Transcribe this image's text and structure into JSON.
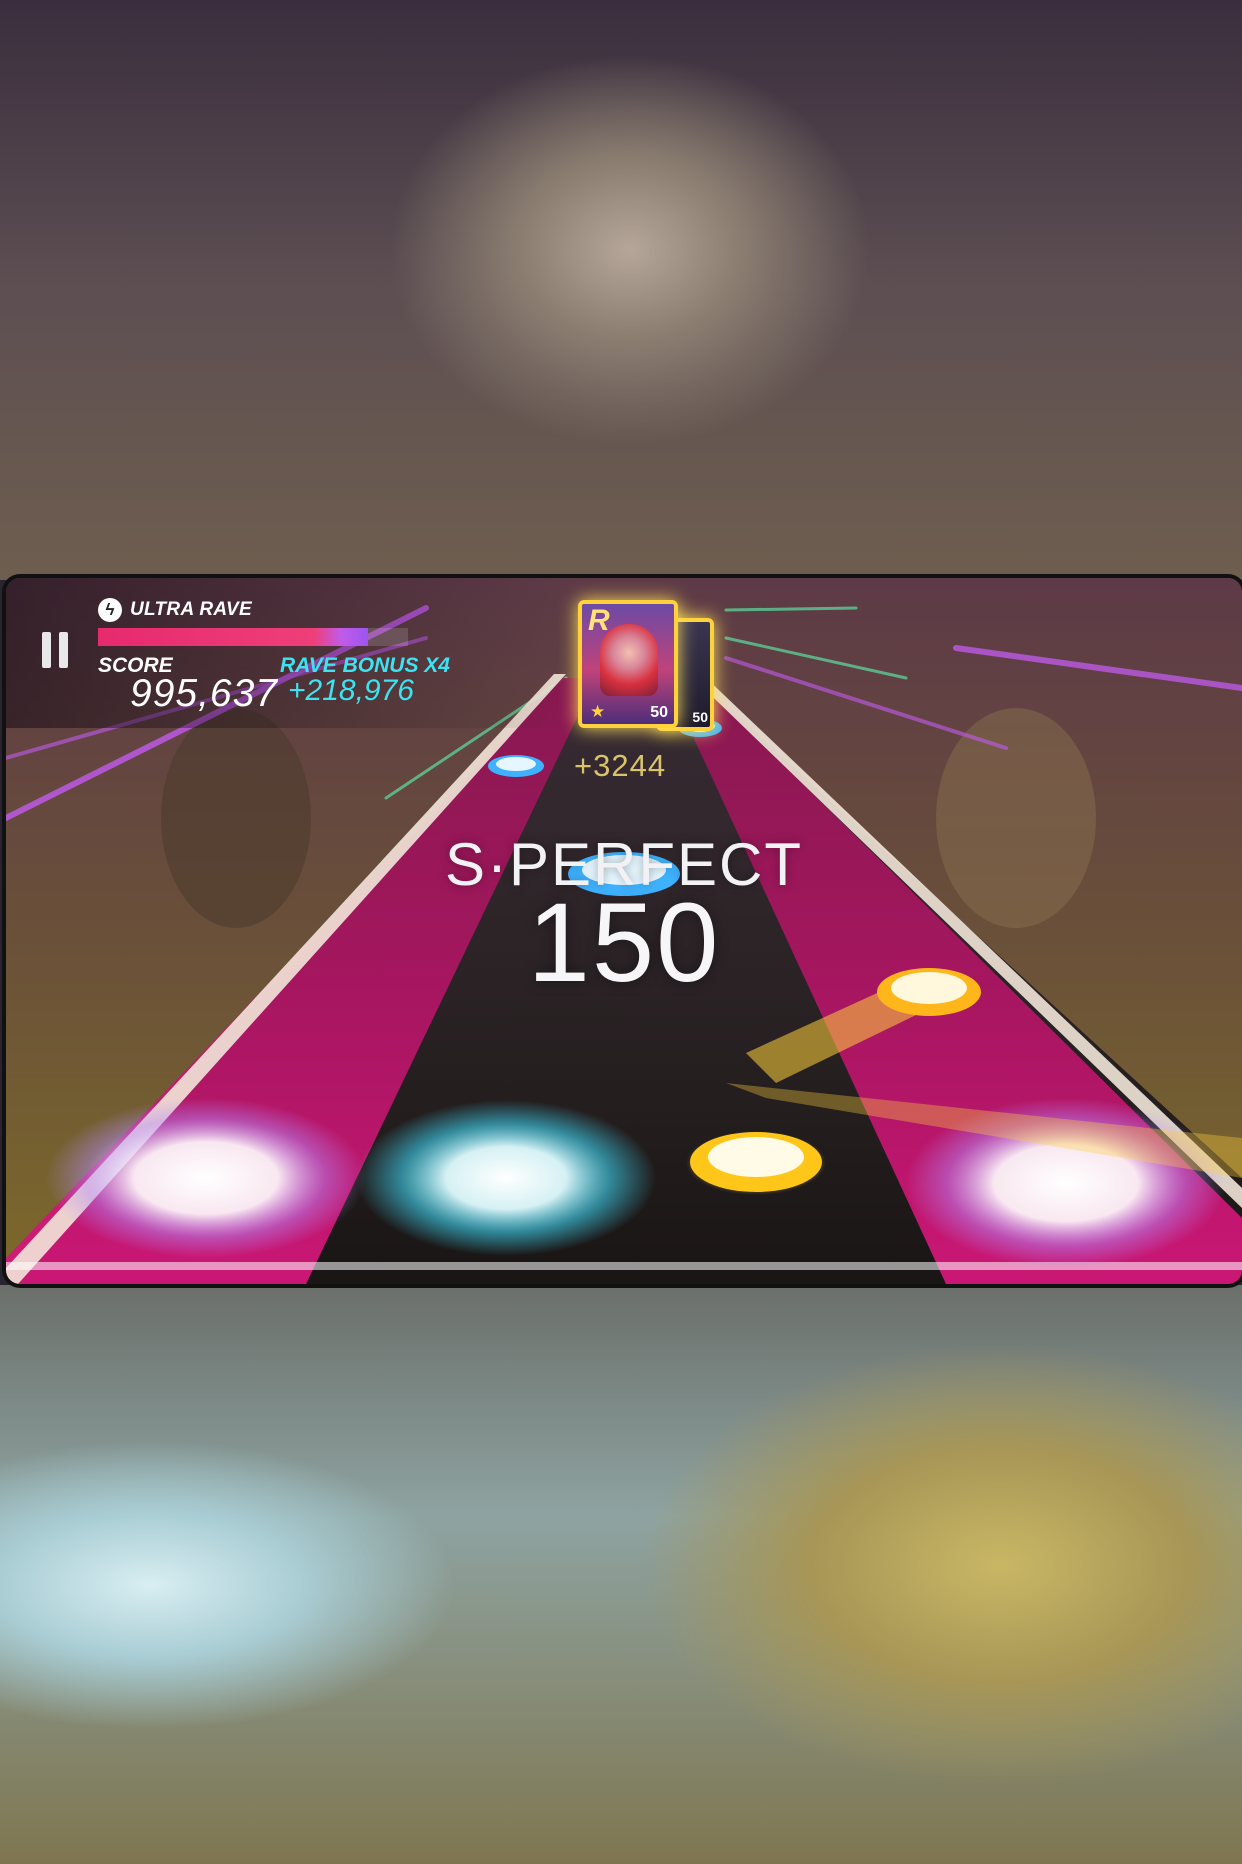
{
  "hud": {
    "mode_label": "ULTRA RAVE",
    "mode_icon": "lightning-bolt-icon",
    "rave_gauge": 0.87,
    "score_label": "SCORE",
    "score_value": "995,637",
    "bonus_label": "RAVE BONUS X4",
    "bonus_value": "+218,976"
  },
  "skill": {
    "points": "+3244",
    "front_card": {
      "grade": "R",
      "level": "50"
    },
    "back_card": {
      "level": "50"
    }
  },
  "judgement": {
    "label": "S·PERFECT",
    "combo": "150"
  },
  "colors": {
    "lane_pink": "#c6146a",
    "lane_dark": "#14121a",
    "note_blue": "#3fb2ff",
    "note_yellow": "#ffd23c",
    "bonus_cyan": "#3ce3f0",
    "gauge_pink": "#e62a6e",
    "gauge_purple": "#9d55f0"
  }
}
